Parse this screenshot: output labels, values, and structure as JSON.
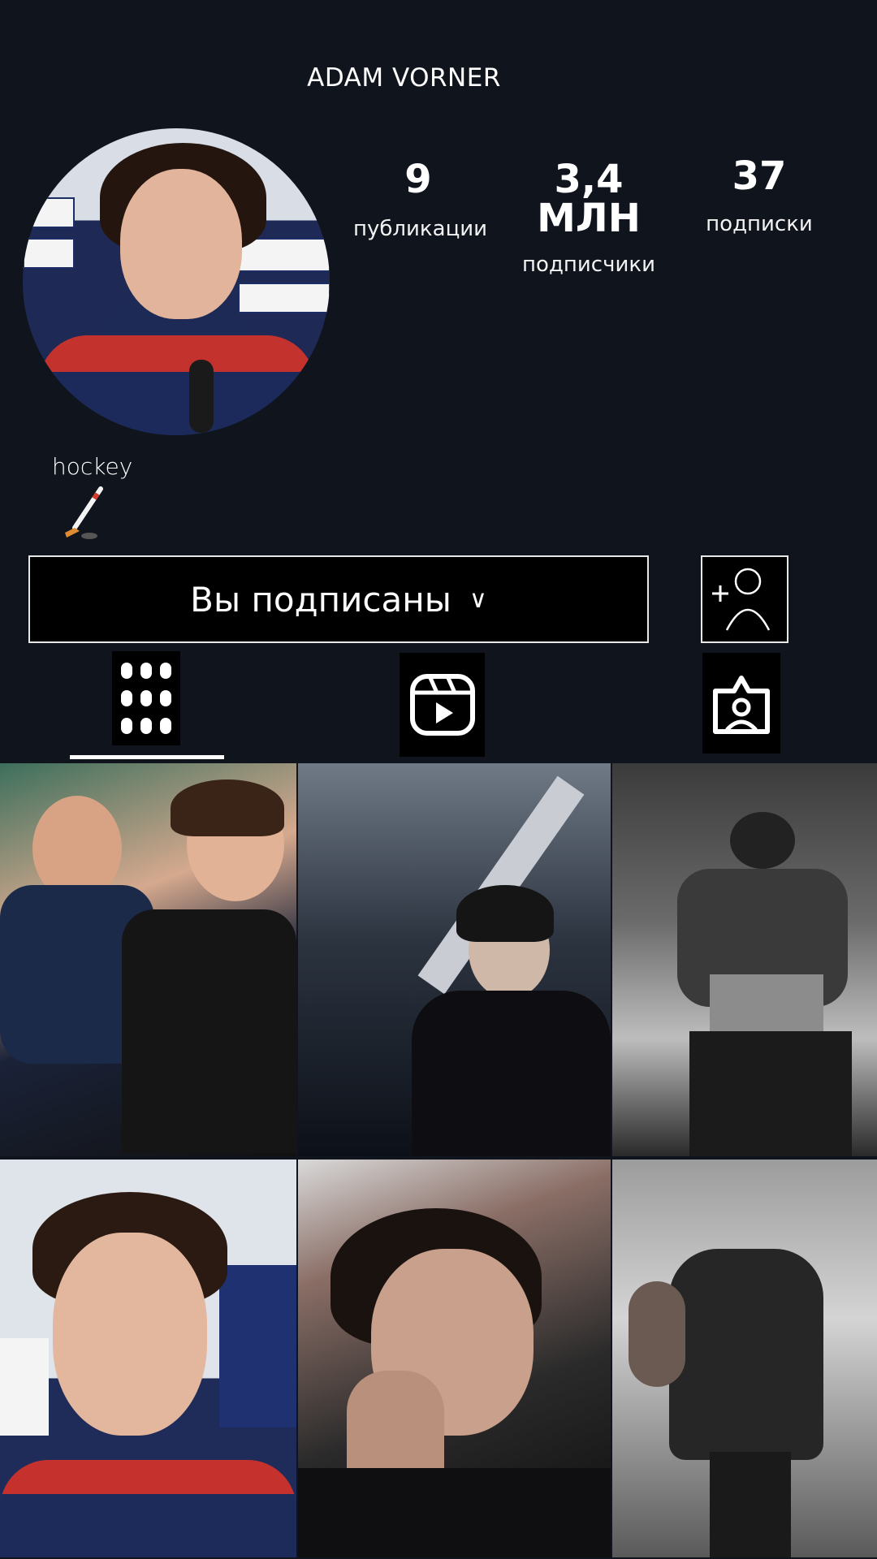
{
  "profile": {
    "username": "ADAM VORNER",
    "bio": "hockey",
    "bio_emoji": "hockey-stick-emoji"
  },
  "stats": [
    {
      "value": "9",
      "label": "публикации"
    },
    {
      "value": "3,4 МЛН",
      "label": "подписчики"
    },
    {
      "value": "37",
      "label": "подписки"
    }
  ],
  "actions": {
    "follow_label": "Вы подписаны",
    "follow_chevron": "∨",
    "add_person_icon": "add-person-icon"
  },
  "tabs": [
    {
      "icon": "grid-icon",
      "active": true
    },
    {
      "icon": "reels-icon",
      "active": false
    },
    {
      "icon": "tagged-icon",
      "active": false
    }
  ],
  "colors": {
    "background": "#0f141d",
    "text": "#ffffff",
    "border": "#e8e8e8"
  }
}
